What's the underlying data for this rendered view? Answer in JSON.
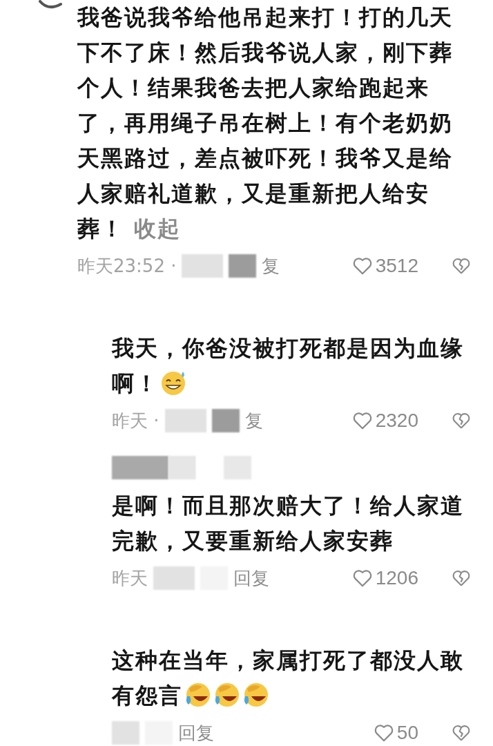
{
  "comment": {
    "text": "我爸说我爷给他吊起来打！打的几天下不了床！然后我爷说人家，刚下葬个人！结果我爸去把人家给跑起来了，再用绳子吊在树上！有个老奶奶天黑路过，差点被吓死！我爷又是给人家赔礼道歉，又是重新把人给安葬！",
    "collapse_link": "收起",
    "time": "昨天23:52 ·",
    "meta_redacted": true,
    "reply": "复",
    "likes": "3512"
  },
  "replies": [
    {
      "text": "我天，你爸没被打死都是因为血缘啊！",
      "emojis": [
        {
          "kind": "grin_sweat"
        }
      ],
      "time": "昨天 ·",
      "meta_redacted": true,
      "reply": "复",
      "likes": "2320"
    },
    {
      "username_redacted": true,
      "text": "是啊！而且那次赔大了！给人家道完歉，又要重新给人家安葬",
      "time": "昨天",
      "meta_redacted": true,
      "reply": "回复",
      "likes": "1206"
    },
    {
      "text": "这种在当年，家属打死了都没人敢有怨言",
      "emojis": [
        {
          "kind": "facepalm_laugh"
        },
        {
          "kind": "facepalm_laugh"
        },
        {
          "kind": "facepalm_laugh"
        }
      ],
      "meta_redacted": true,
      "reply": "回复",
      "likes": "50"
    }
  ]
}
